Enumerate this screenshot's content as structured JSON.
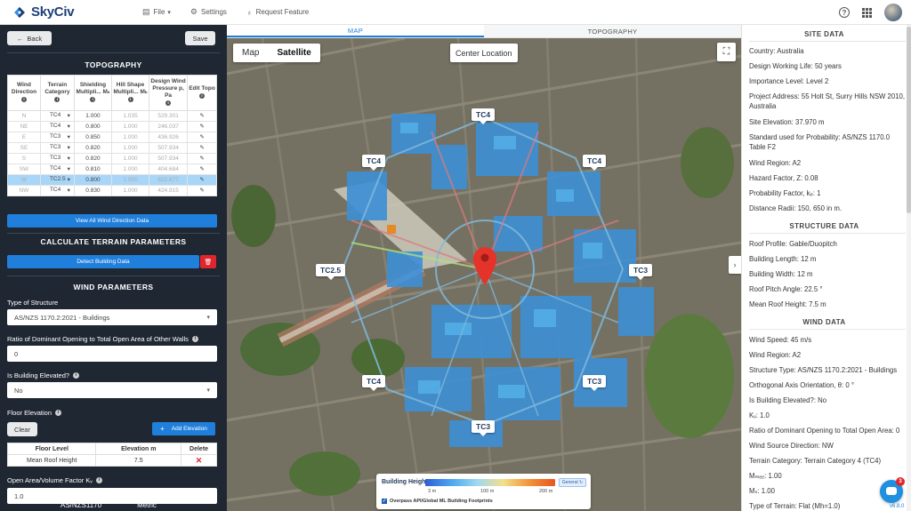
{
  "app": {
    "brand": "SkyCiv",
    "menu": [
      {
        "label": "File",
        "icon": "file-icon",
        "has_caret": true
      },
      {
        "label": "Settings",
        "icon": "gears-icon",
        "has_caret": false
      },
      {
        "label": "Request Feature",
        "icon": "lightbulb-icon",
        "has_caret": false
      }
    ]
  },
  "sidebar": {
    "back_label": "Back",
    "save_label": "Save",
    "topography": {
      "title": "TOPOGRAPHY",
      "headers": [
        "Wind Direction",
        "Terrain Category",
        "Shielding Multipli... Mₛ",
        "Hill Shape Multipli... Mₕ",
        "Design Wind Pressure p, Pa",
        "Edit Topo"
      ],
      "rows": [
        {
          "dir": "N",
          "tc": "TC4",
          "ms": "1.000",
          "mh": "1.035",
          "p": "529.301"
        },
        {
          "dir": "NE",
          "tc": "TC4",
          "ms": "0.800",
          "mh": "1.000",
          "p": "246.037"
        },
        {
          "dir": "E",
          "tc": "TC3",
          "ms": "0.850",
          "mh": "1.000",
          "p": "436.926"
        },
        {
          "dir": "SE",
          "tc": "TC3",
          "ms": "0.820",
          "mh": "1.000",
          "p": "507.934"
        },
        {
          "dir": "S",
          "tc": "TC3",
          "ms": "0.820",
          "mh": "1.000",
          "p": "507.934"
        },
        {
          "dir": "SW",
          "tc": "TC4",
          "ms": "0.810",
          "mh": "1.000",
          "p": "404.684"
        },
        {
          "dir": "W",
          "tc": "TC2.5",
          "ms": "0.800",
          "mh": "1.000",
          "p": "622.877"
        },
        {
          "dir": "NW",
          "tc": "TC4",
          "ms": "0.830",
          "mh": "1.000",
          "p": "424.915"
        }
      ],
      "view_all_label": "View All Wind Direction Data"
    },
    "terrain": {
      "title": "CALCULATE TERRAIN PARAMETERS",
      "detect_label": "Detect Building Data"
    },
    "wind": {
      "title": "WIND PARAMETERS",
      "structure_label": "Type of Structure",
      "structure_value": "AS/NZS 1170.2:2021 - Buildings",
      "ratio_label": "Ratio of Dominant Opening to Total Open Area of Other Walls",
      "ratio_value": "0",
      "elevated_label": "Is Building Elevated?",
      "elevated_value": "No",
      "floor_label": "Floor Elevation",
      "clear_label": "Clear",
      "add_label": "Add Elevation",
      "floor_headers": [
        "Floor Level",
        "Elevation m",
        "Delete"
      ],
      "floor_rows": [
        {
          "level": "Mean Roof Height",
          "elev": "7.5"
        }
      ],
      "kv_label": "Open Area/Volume Factor Kᵥ",
      "kv_value": "1.0"
    },
    "footer": {
      "code": "AS/NZS1170",
      "units": "Metric"
    }
  },
  "map": {
    "tabs": [
      "MAP",
      "TOPOGRAPHY"
    ],
    "type_buttons": [
      "Map",
      "Satellite"
    ],
    "center_label": "Center Location",
    "terrain_labels": [
      "TC4",
      "TC4",
      "TC4",
      "TC2.5",
      "TC3",
      "TC4",
      "TC3",
      "TC3"
    ],
    "legend": {
      "title": "Building Height",
      "ticks": [
        "3 m",
        "100 m",
        "200 m"
      ],
      "general_label": "General",
      "checkbox_label": "Overpass API/Global ML Building Footprints"
    }
  },
  "right": {
    "site_title": "SITE DATA",
    "site": [
      "Country: Australia",
      "Design Working Life: 50 years",
      "Importance Level: Level 2",
      "Project Address: 55 Holt St, Surry Hills NSW 2010, Australia",
      "Site Elevation: 37.970 m",
      "Standard used for Probability: AS/NZS 1170.0 Table F2",
      "Wind Region: A2",
      "Hazard Factor, Z: 0.08",
      "Probability Factor, kₚ: 1",
      "Distance Radii: 150, 650 in m."
    ],
    "structure_title": "STRUCTURE DATA",
    "structure": [
      "Roof Profile: Gable/Duopitch",
      "Building Length: 12 m",
      "Building Width: 12 m",
      "Roof Pitch Angle: 22.5 °",
      "Mean Roof Height: 7.5 m"
    ],
    "wind_title": "WIND DATA",
    "wind": [
      "Wind Speed: 45 m/s",
      "Wind Region: A2",
      "Structure Type: AS/NZS 1170.2:2021 - Buildings",
      "Orthogonal Axis Orientation, θ: 0 °",
      "Is Building Elevated?: No",
      "Kᵥ: 1.0",
      "Ratio of Dominant Opening to Total Open Area: 0",
      "Wind Source Direction: NW",
      "Terrain Category: Terrain Category 4 (TC4)",
      "Mₘₑₑ: 1.00",
      "Mₛ: 1.00",
      "Type of Terrain: Flat (Mh=1.0)"
    ],
    "version": "v6.8.0",
    "chat_badge": "3"
  },
  "colors": {
    "accent": "#1f7fdb",
    "sidebar_bg": "#1f2733",
    "danger": "#e0262c",
    "selected_row": "#a8d6f8"
  }
}
